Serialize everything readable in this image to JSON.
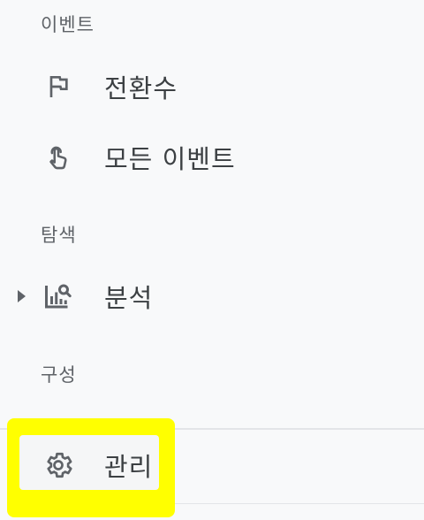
{
  "sections": {
    "events": {
      "label": "이벤트"
    },
    "explore": {
      "label": "탐색"
    },
    "configure": {
      "label": "구성"
    }
  },
  "nav": {
    "conversions": {
      "label": "전환수",
      "icon": "flag-icon"
    },
    "all_events": {
      "label": "모든 이벤트",
      "icon": "touch-icon"
    },
    "analysis": {
      "label": "분석",
      "icon": "analytics-search-icon",
      "expandable": true
    },
    "admin": {
      "label": "관리",
      "icon": "gear-icon"
    }
  },
  "colors": {
    "background": "#f8f9fa",
    "highlight": "#ffff00",
    "text": "#3c4043",
    "muted": "#5f6368"
  }
}
